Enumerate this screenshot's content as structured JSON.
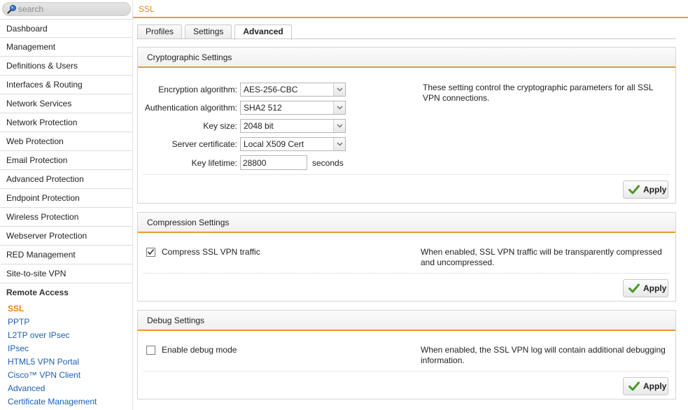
{
  "search": {
    "placeholder": "search"
  },
  "sidebar": {
    "items": [
      {
        "label": "Dashboard"
      },
      {
        "label": "Management"
      },
      {
        "label": "Definitions & Users"
      },
      {
        "label": "Interfaces & Routing"
      },
      {
        "label": "Network Services"
      },
      {
        "label": "Network Protection"
      },
      {
        "label": "Web Protection"
      },
      {
        "label": "Email Protection"
      },
      {
        "label": "Advanced Protection"
      },
      {
        "label": "Endpoint Protection"
      },
      {
        "label": "Wireless Protection"
      },
      {
        "label": "Webserver Protection"
      },
      {
        "label": "RED Management"
      },
      {
        "label": "Site-to-site VPN"
      }
    ],
    "section": {
      "label": "Remote Access"
    },
    "subitems": [
      {
        "label": "SSL",
        "active": true
      },
      {
        "label": "PPTP"
      },
      {
        "label": "L2TP over IPsec"
      },
      {
        "label": "IPsec"
      },
      {
        "label": "HTML5 VPN Portal"
      },
      {
        "label": "Cisco™ VPN Client"
      },
      {
        "label": "Advanced"
      },
      {
        "label": "Certificate Management"
      }
    ]
  },
  "header": {
    "title": "SSL"
  },
  "tabs": [
    {
      "label": "Profiles"
    },
    {
      "label": "Settings"
    },
    {
      "label": "Advanced",
      "active": true
    }
  ],
  "crypto": {
    "title": "Cryptographic Settings",
    "encryption_label": "Encryption algorithm:",
    "encryption_value": "AES-256-CBC",
    "auth_label": "Authentication algorithm:",
    "auth_value": "SHA2 512",
    "keysize_label": "Key size:",
    "keysize_value": "2048 bit",
    "cert_label": "Server certificate:",
    "cert_value": "Local X509 Cert",
    "lifetime_label": "Key lifetime:",
    "lifetime_value": "28800",
    "lifetime_unit": "seconds",
    "help": "These setting control the cryptographic parameters for all SSL VPN connections.",
    "apply_label": "Apply"
  },
  "compression": {
    "title": "Compression Settings",
    "checkbox_label": "Compress SSL VPN traffic",
    "checked": true,
    "help": "When enabled, SSL VPN traffic will be transparently compressed and uncompressed.",
    "apply_label": "Apply"
  },
  "debug": {
    "title": "Debug Settings",
    "checkbox_label": "Enable debug mode",
    "checked": false,
    "help": "When enabled, the SSL VPN log will contain additional debugging information.",
    "apply_label": "Apply"
  },
  "colors": {
    "accent": "#e89a2c",
    "link": "#1a5fb4",
    "active_link": "#e08a10",
    "apply_check": "#4a9a2a"
  }
}
